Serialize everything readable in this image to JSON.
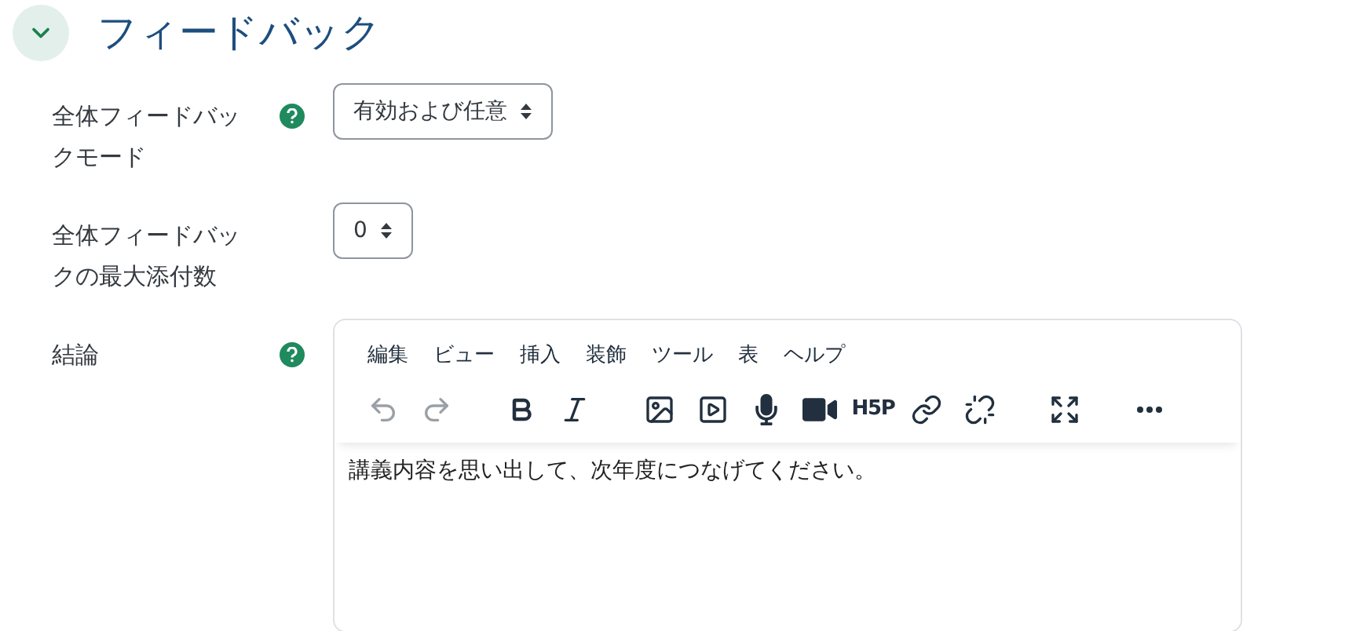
{
  "section": {
    "title": "フィードバック",
    "expanded": true
  },
  "fields": [
    {
      "kind": "select",
      "label": "全体フィードバックモード",
      "help": true,
      "value": "有効および任意"
    },
    {
      "kind": "select",
      "label": "全体フィードバックの最大添付数",
      "help": false,
      "value": "0"
    },
    {
      "kind": "editor",
      "label": "結論",
      "help": true,
      "menu": [
        "編集",
        "ビュー",
        "挿入",
        "装飾",
        "ツール",
        "表",
        "ヘルプ"
      ],
      "toolbar": [
        {
          "kind": "undo",
          "disabled": true
        },
        {
          "kind": "redo",
          "disabled": true
        },
        {
          "kind": "bold",
          "disabled": false
        },
        {
          "kind": "italic",
          "disabled": false
        },
        {
          "kind": "image",
          "disabled": false
        },
        {
          "kind": "media",
          "disabled": false
        },
        {
          "kind": "mic",
          "disabled": false
        },
        {
          "kind": "video",
          "disabled": false
        },
        {
          "kind": "h5p",
          "disabled": false,
          "label": "H5P"
        },
        {
          "kind": "link",
          "disabled": false
        },
        {
          "kind": "unlink",
          "disabled": false
        },
        {
          "kind": "fullscreen",
          "disabled": false
        },
        {
          "kind": "more",
          "disabled": false
        }
      ],
      "content": "講義内容を思い出して、次年度につなげてください。"
    }
  ]
}
